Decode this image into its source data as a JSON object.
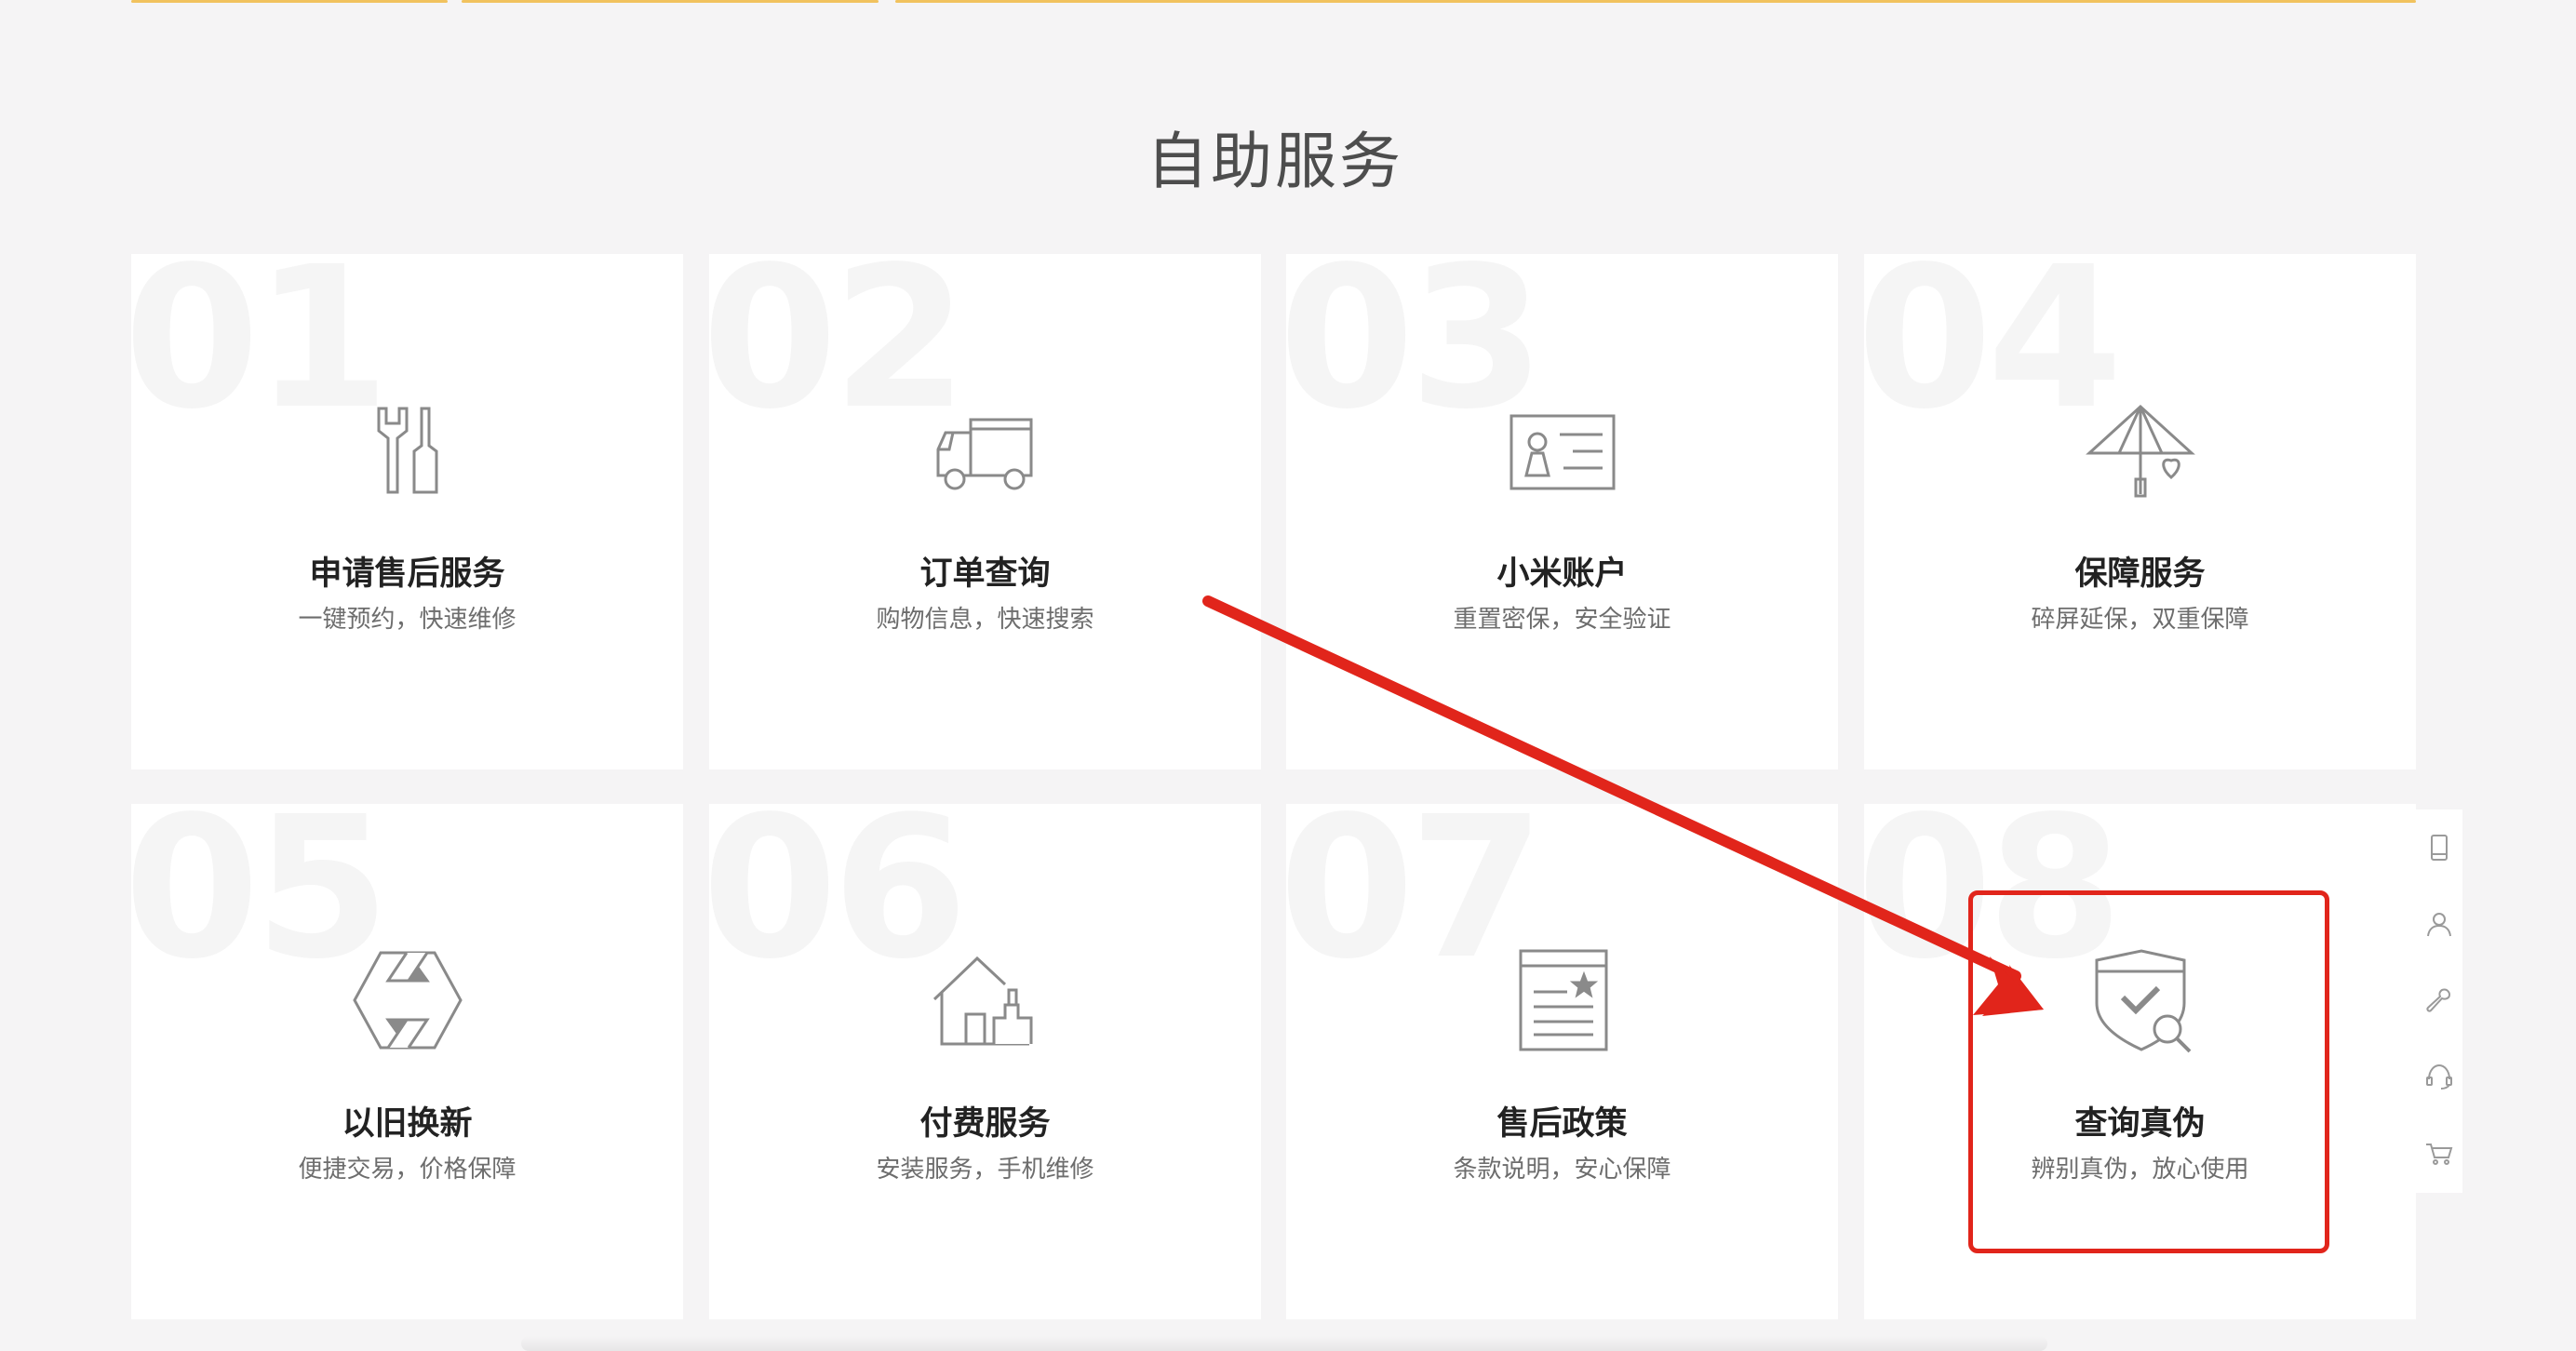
{
  "section": {
    "title": "自助服务"
  },
  "cards": [
    {
      "num": "01",
      "title": "申请售后服务",
      "desc": "一键预约，快速维修",
      "icon": "wrench-tools-icon"
    },
    {
      "num": "02",
      "title": "订单查询",
      "desc": "购物信息，快速搜索",
      "icon": "delivery-truck-icon"
    },
    {
      "num": "03",
      "title": "小米账户",
      "desc": "重置密保，安全验证",
      "icon": "id-card-icon"
    },
    {
      "num": "04",
      "title": "保障服务",
      "desc": "碎屏延保，双重保障",
      "icon": "umbrella-heart-icon"
    },
    {
      "num": "05",
      "title": "以旧换新",
      "desc": "便捷交易，价格保障",
      "icon": "exchange-hexagon-icon"
    },
    {
      "num": "06",
      "title": "付费服务",
      "desc": "安装服务，手机维修",
      "icon": "house-service-icon"
    },
    {
      "num": "07",
      "title": "售后政策",
      "desc": "条款说明，安心保障",
      "icon": "policy-document-icon"
    },
    {
      "num": "08",
      "title": "查询真伪",
      "desc": "辨别真伪，放心使用",
      "icon": "shield-search-icon"
    }
  ],
  "side_toolbar": [
    {
      "icon": "phone-icon"
    },
    {
      "icon": "user-icon"
    },
    {
      "icon": "wrench-icon"
    },
    {
      "icon": "headset-icon"
    },
    {
      "icon": "cart-icon"
    }
  ],
  "colors": {
    "background": "#f5f4f5",
    "card": "#ffffff",
    "annotation_red": "#e1251b",
    "icon_gray": "#8a8a8a",
    "top_accent": "#f1c25e"
  }
}
